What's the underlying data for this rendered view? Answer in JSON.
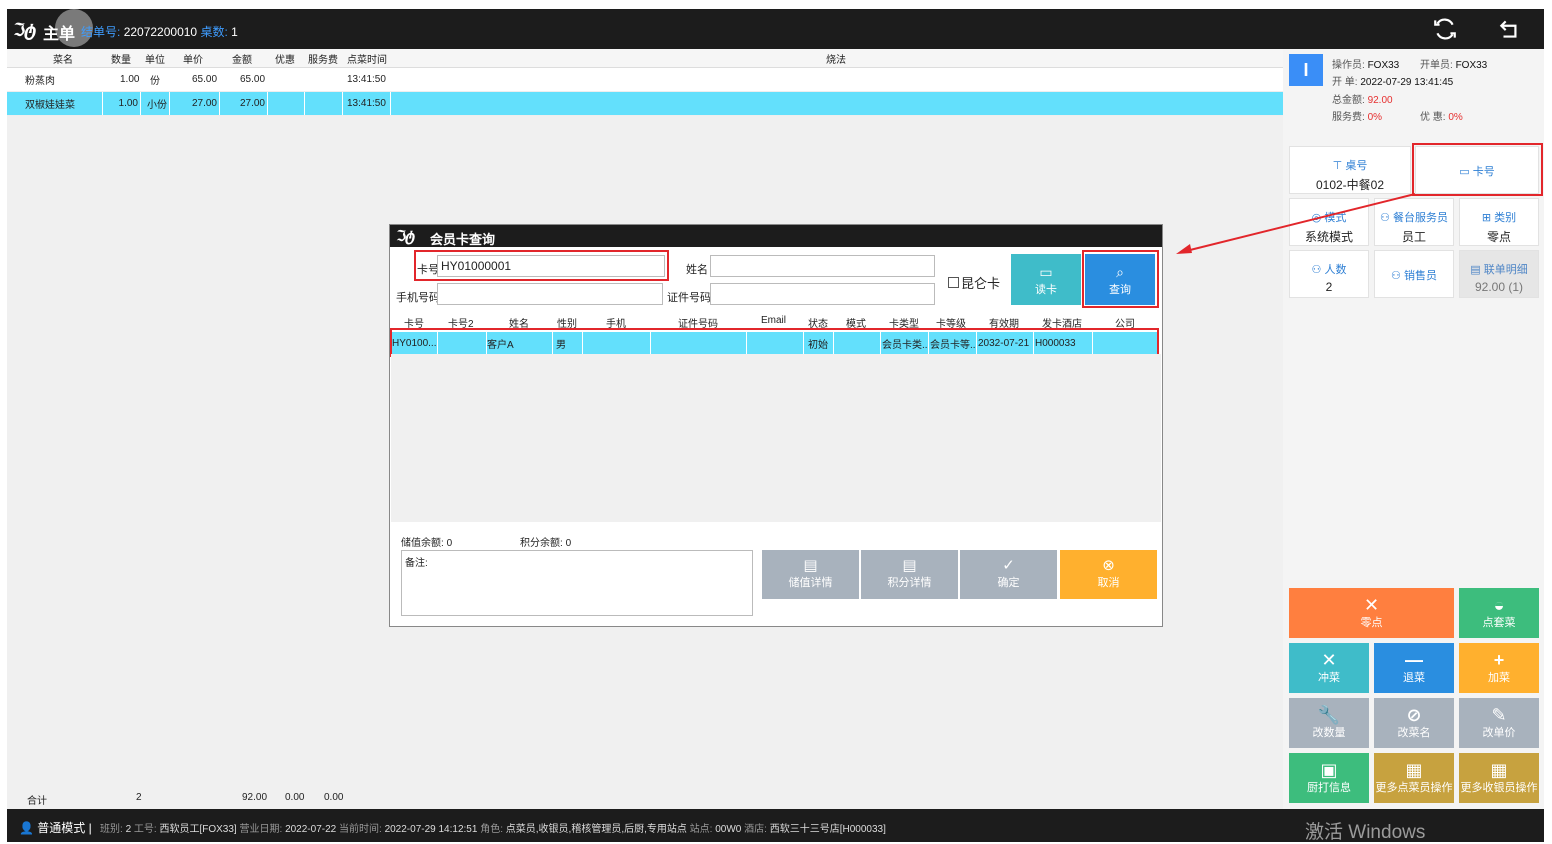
{
  "topbar": {
    "logo": "ℑტ",
    "app_name": "主单",
    "order_label": "结单号:",
    "order_no": "22072200010",
    "table_count_label": "桌数:",
    "table_count": "1"
  },
  "order_table": {
    "headers": [
      "菜名",
      "数量",
      "单位",
      "单价",
      "金额",
      "优惠",
      "服务费",
      "点菜时间",
      "烧法"
    ],
    "rows": [
      {
        "name": "粉蒸肉",
        "qty": "1.00",
        "unit": "份",
        "price": "65.00",
        "amount": "65.00",
        "discount": "",
        "service": "",
        "time": "13:41:50",
        "method": ""
      },
      {
        "name": "双椒娃娃菜",
        "qty": "1.00",
        "unit": "小份",
        "price": "27.00",
        "amount": "27.00",
        "discount": "",
        "service": "",
        "time": "13:41:50",
        "method": ""
      }
    ]
  },
  "totals": {
    "label": "合计",
    "qty": "2",
    "amount": "92.00",
    "discount": "0.00",
    "service": "0.00"
  },
  "status_bar": {
    "mode": "普通模式",
    "shift_label": "班别:",
    "shift": "2",
    "emp_label": "工号:",
    "emp": "西软员工[FOX33]",
    "bizdate_label": "营业日期:",
    "bizdate": "2022-07-22",
    "now_label": "当前时间:",
    "now": "2022-07-29 14:12:51",
    "role_label": "角色:",
    "role": "点菜员,收银员,稽核管理员,后厨,专用站点",
    "site_label": "站点:",
    "site": "00W0",
    "hotel_label": "酒店:",
    "hotel": "西软三十三号店[H000033]",
    "watermark": "激活 Windows"
  },
  "right_info": {
    "badge": "I",
    "operator_label": "操作员:",
    "operator": "FOX33",
    "opener_label": "开单员:",
    "opener": "FOX33",
    "open_label": "开 单:",
    "open_time": "2022-07-29 13:41:45",
    "total_label": "总金额:",
    "total": "92.00",
    "service_label": "服务费:",
    "service": "0%",
    "discount_label": "优 惠:",
    "discount": "0%"
  },
  "tiles": {
    "table": {
      "title": "桌号",
      "value": "0102-中餐02"
    },
    "card": {
      "title": "卡号"
    },
    "mode": {
      "title": "模式",
      "value": "系统模式"
    },
    "waiter": {
      "title": "餐台服务员",
      "value": "员工"
    },
    "category": {
      "title": "类别",
      "value": "零点"
    },
    "guests": {
      "title": "人数",
      "value": "2"
    },
    "sales": {
      "title": "销售员"
    },
    "joint": {
      "title": "联单明细",
      "value": "92.00 (1)"
    }
  },
  "actions": {
    "lingdian": "零点",
    "taocai": "点套菜",
    "chongcai": "冲菜",
    "tuicai": "退菜",
    "jiacai": "加菜",
    "gaishuliang": "改数量",
    "gaicaiming": "改菜名",
    "gaidanjia": "改单价",
    "chudayin": "厨打信息",
    "more_dish": "更多点菜员操作",
    "more_cash": "更多收银员操作"
  },
  "dialog": {
    "title": "会员卡查询",
    "card_label": "卡号",
    "card_value": "HY01000001",
    "name_label": "姓名",
    "phone_label": "手机号码",
    "id_label": "证件号码",
    "kunlun_label": "昆仑卡",
    "read_card": "读卡",
    "query": "查询",
    "grid_headers": [
      "卡号",
      "卡号2",
      "姓名",
      "性别",
      "手机",
      "证件号码",
      "Email",
      "状态",
      "模式",
      "卡类型",
      "卡等级",
      "有效期",
      "发卡酒店",
      "公司"
    ],
    "grid_row": [
      "HY0100...",
      "",
      "客户A",
      "男",
      "",
      "",
      "",
      "初始",
      "",
      "会员卡类...",
      "会员卡等...",
      "2032-07-21",
      "H000033",
      ""
    ],
    "stored_label": "储值余额:",
    "stored": "0",
    "points_label": "积分余额:",
    "points": "0",
    "note_label": "备注:",
    "btn_stored_detail": "储值详情",
    "btn_points_detail": "积分详情",
    "btn_ok": "确定",
    "btn_cancel": "取消"
  },
  "colors": {
    "accent_blue": "#3a8ef7",
    "highlight_cyan": "#63e0fc",
    "annotation_red": "#e2262b",
    "orange": "#ff7f3f",
    "green": "#3dbd7d",
    "teal": "#3fbcc9",
    "blue": "#2a8ee0",
    "yellow": "#ffb02e",
    "gray": "#a8b2bd",
    "gold": "#c7a23f"
  }
}
